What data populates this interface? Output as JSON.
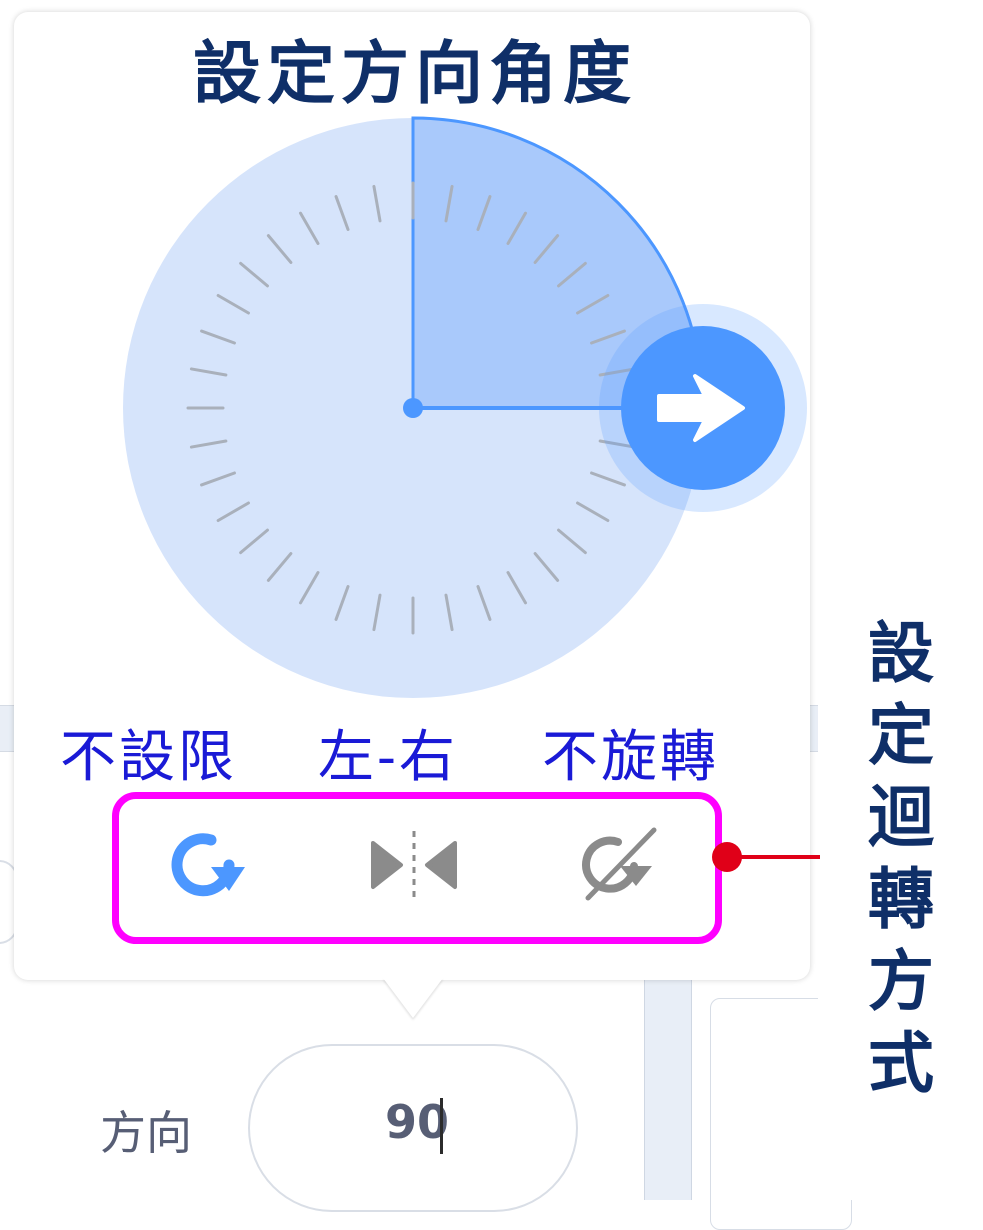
{
  "annotations": {
    "title": "設定方向角度",
    "side_label": "設定迴轉方式"
  },
  "direction": {
    "degrees": 90
  },
  "rotation_modes": [
    {
      "label": "不設限",
      "icon": "rotate-all-around-icon",
      "selected": true
    },
    {
      "label": "左-右",
      "icon": "left-right-flip-icon",
      "selected": false
    },
    {
      "label": "不旋轉",
      "icon": "dont-rotate-icon",
      "selected": false
    }
  ],
  "field": {
    "label": "方向",
    "value": "90"
  },
  "colors": {
    "dial_fill": "#d6e4fb",
    "dial_sector": "#a9c9fb",
    "accent": "#4c97ff",
    "annotation_navy": "#0f2f68",
    "annotation_blue": "#1a1ad6",
    "highlight_magenta": "#ff00ff",
    "callout_red": "#e00018",
    "icon_gray": "#8b8b8b"
  }
}
